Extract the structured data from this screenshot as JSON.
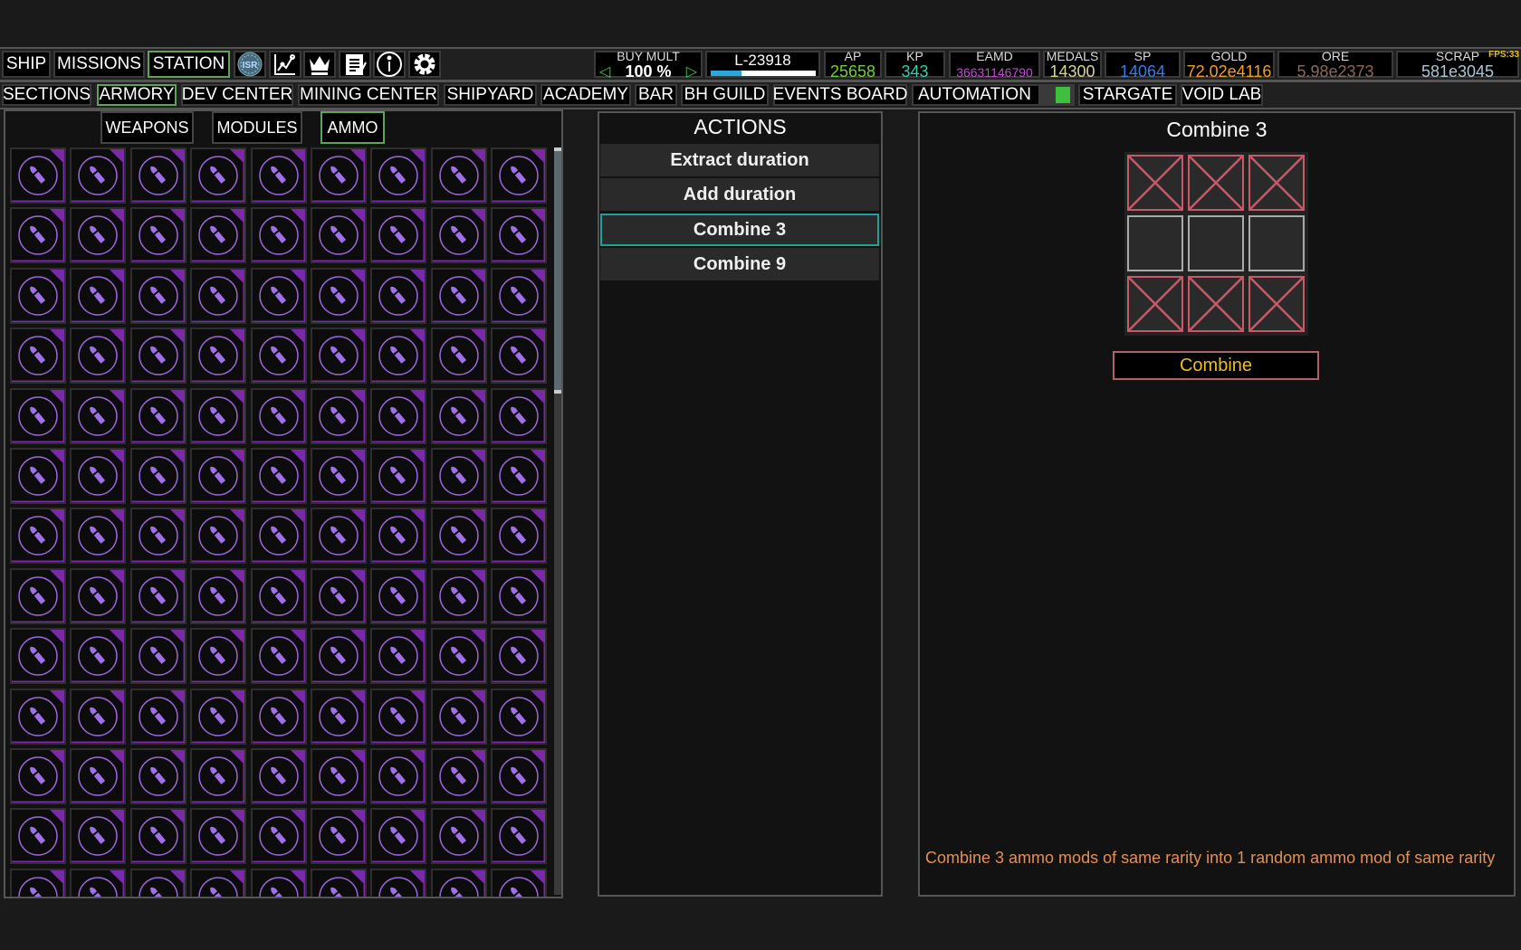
{
  "top_nav": {
    "tabs": [
      "SHIP",
      "MISSIONS",
      "STATION"
    ],
    "active": "STATION",
    "icons": [
      "isr-icon",
      "chart-icon",
      "crown-icon",
      "notepad-icon",
      "info-icon",
      "gear-icon"
    ],
    "isr_text": "ISR"
  },
  "buy_mult": {
    "label": "BUY MULT",
    "value": "100 %"
  },
  "level": {
    "label": "L-23918",
    "progress": 0.3
  },
  "stats": [
    {
      "label": "AP",
      "value": "25658",
      "color": "#6fd13a"
    },
    {
      "label": "KP",
      "value": "343",
      "color": "#2fd0b0"
    },
    {
      "label": "EAMD",
      "value": "36631146790",
      "color": "#c050d0"
    },
    {
      "label": "MEDALS",
      "value": "14300",
      "color": "#d8d890"
    },
    {
      "label": "SP",
      "value": "14064",
      "color": "#3a7ee0"
    },
    {
      "label": "GOLD",
      "value": "72.02e4116",
      "color": "#f0a020"
    },
    {
      "label": "ORE",
      "value": "5.98e2373",
      "color": "#8a6a5a"
    },
    {
      "label": "SCRAP",
      "value": "581e3045",
      "color": "#a8c8d8"
    }
  ],
  "fps": "FPS:33",
  "sections": [
    "SECTIONS",
    "ARMORY",
    "DEV CENTER",
    "MINING CENTER",
    "SHIPYARD",
    "ACADEMY",
    "BAR",
    "BH GUILD",
    "EVENTS BOARD",
    "AUTOMATION",
    "STARGATE",
    "VOID LAB"
  ],
  "active_section": "ARMORY",
  "automation_toggle": true,
  "armory": {
    "tabs": [
      "WEAPONS",
      "MODULES",
      "AMMO"
    ],
    "active": "AMMO",
    "item_icon": "bullet-icon",
    "rarity_color": "#7a2aa8"
  },
  "actions": {
    "title": "ACTIONS",
    "items": [
      "Extract duration",
      "Add duration",
      "Combine 3",
      "Combine 9"
    ],
    "selected": "Combine 3"
  },
  "detail": {
    "title": "Combine 3",
    "slots": [
      "locked",
      "locked",
      "locked",
      "empty",
      "empty",
      "empty",
      "locked",
      "locked",
      "locked"
    ],
    "button": "Combine",
    "description": "Combine 3 ammo mods of same rarity into 1 random ammo mod of same rarity"
  }
}
